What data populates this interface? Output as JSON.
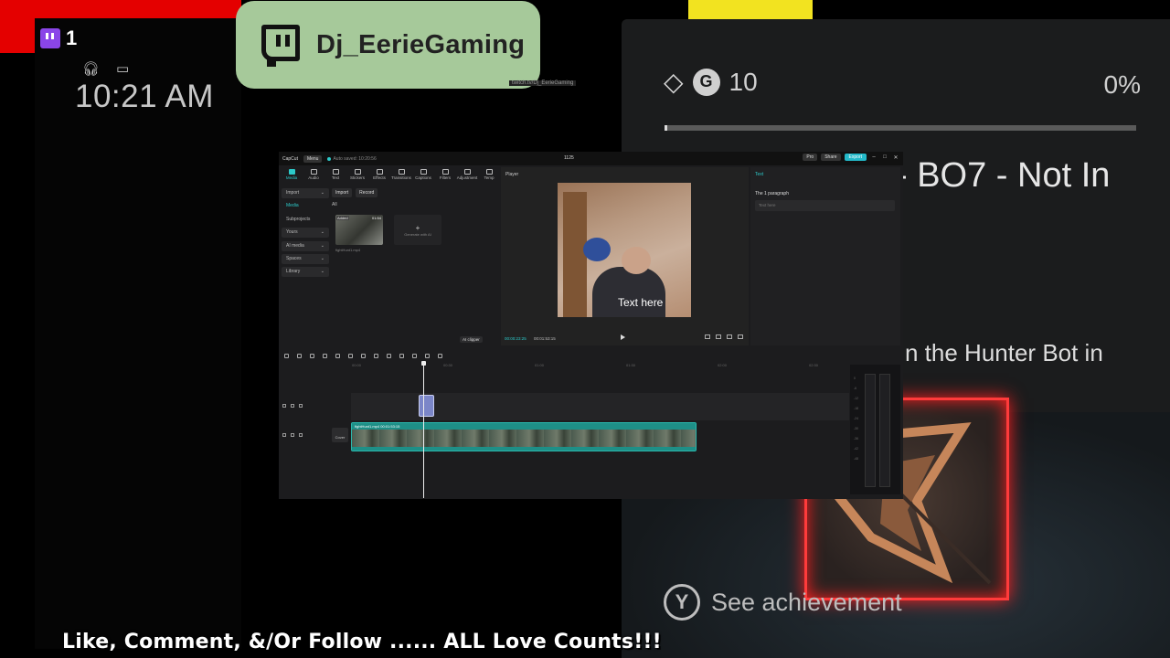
{
  "overlay": {
    "viewer_count": "1",
    "clock": "10:21 AM",
    "channel_name": "Dj_EerieGaming",
    "channel_sub": "twitch.tv/Dj_EerieGaming",
    "banner": "Like, Comment, &/Or Follow ...... ALL Love Counts!!!"
  },
  "achievement": {
    "gamerscore": "10",
    "percent": "0%",
    "progress": 0.0,
    "title_partial": "- BO7 - Not In",
    "desc_partial": "n the Hunter Bot in",
    "see_achievement": "See achievement",
    "y_button": "Y"
  },
  "capcut": {
    "app": "CapCut",
    "menu": "Menu",
    "autosave": "Auto saved: 10:20:56",
    "project": "1125",
    "pro": "Pro",
    "share": "Share",
    "export": "Export",
    "tools": [
      "Media",
      "Audio",
      "Text",
      "Stickers",
      "Effects",
      "Transitions",
      "Captions",
      "Filters",
      "Adjustment",
      "Temp"
    ],
    "sidebar": [
      "Import",
      "Media",
      "Subprojects",
      "Yours",
      "AI media",
      "Spaces",
      "Library"
    ],
    "import_btn": "Import",
    "record_btn": "Record",
    "all_label": "All",
    "clip_added": "Added",
    "clip_duration": "01:54",
    "clip_filename": "fightHunt1.mp4",
    "generate": "Generate with AI",
    "ai_clipper": "AI clipper",
    "player_label": "Player",
    "video_text": "Text here",
    "time_current": "00:00:23:25",
    "time_total": "00:01:53:15",
    "props_tab": "Text",
    "props_label": "The 1 paragraph",
    "props_placeholder": "Text here",
    "ruler": [
      "00:00",
      "00:30",
      "01:00",
      "01:30",
      "02:00",
      "02:30"
    ],
    "main_clip_label": "fightHunt1.mp4   00:01:53:15",
    "cover": "Cover",
    "meter_labels": [
      "0",
      "-6",
      "-12",
      "-18",
      "-24",
      "-30",
      "-36",
      "-42",
      "-48"
    ]
  },
  "colors": {
    "twitch_purple": "#8a45e8",
    "badge_green": "#a6c99a",
    "capcut_teal": "#2cc9c9",
    "alert_red": "#ff3b3b"
  }
}
